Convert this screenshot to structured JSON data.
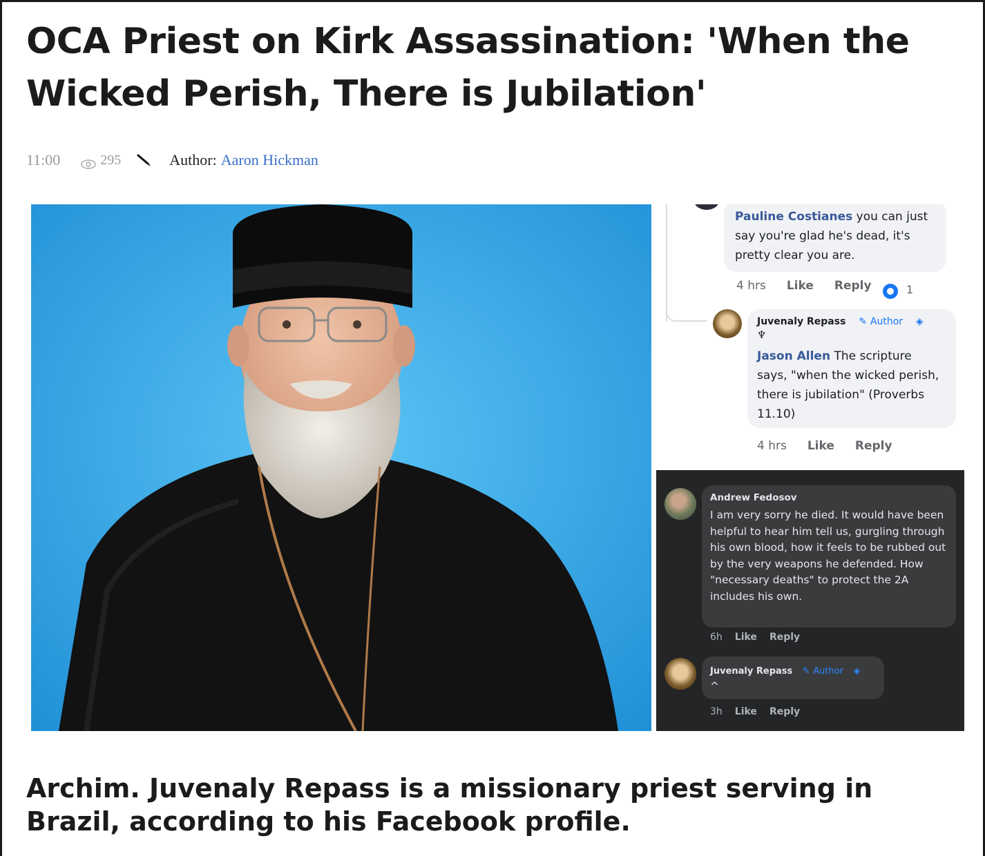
{
  "article": {
    "title": "OCA Priest on Kirk Assassination: 'When the Wicked Perish, There is Jubilation'",
    "time": "11:00",
    "views": "295",
    "author_label": "Author:",
    "author_name": "Aaron Hickman",
    "caption": "Archim. Juvenaly Repass is a missionary priest serving in Brazil, according to his Facebook profile."
  },
  "fb_light": {
    "comment1": {
      "mention": "Pauline Costianes",
      "text": "you can just say you're glad he's dead, it's pretty clear you are.",
      "time": "4 hrs",
      "like": "Like",
      "reply": "Reply",
      "reaction_count": "1"
    },
    "comment2": {
      "author": "Juvenaly Repass",
      "badge": "Author",
      "mention": "Jason Allen",
      "text": "The scripture says, \"when the wicked perish, there is jubilation\" (Proverbs 11.10)",
      "time": "4 hrs",
      "like": "Like",
      "reply": "Reply"
    }
  },
  "fb_dark": {
    "comment1": {
      "author": "Andrew Fedosov",
      "text": "I am very sorry he died. It would have been helpful to hear him tell us, gurgling through his own blood, how it feels to be rubbed out by the very weapons he defended. How \"necessary deaths\" to protect the 2A includes his own.",
      "time": "6h",
      "like": "Like",
      "reply": "Reply"
    },
    "comment2": {
      "author": "Juvenaly Repass",
      "badge": "Author",
      "text": "^",
      "time": "3h",
      "like": "Like",
      "reply": "Reply"
    }
  },
  "colors": {
    "link_blue": "#3b6fc7",
    "photo_background": "#2ea2e6",
    "fb_dark_bg": "#242526",
    "fb_bubble_light": "#f0f2f5"
  },
  "icons": {
    "views": "eye-icon",
    "author": "pencil-icon",
    "reaction": "like-reaction-icon",
    "verified": "diamond-badge-icon"
  }
}
